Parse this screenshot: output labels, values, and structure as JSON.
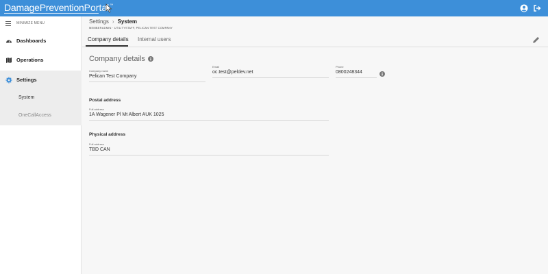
{
  "app": {
    "brand_part1": "DamagePrevention",
    "brand_part2": "Portal",
    "brand_tm": "™"
  },
  "sidebar": {
    "minimize_label": "MINIMIZE MENU",
    "items": [
      {
        "label": "Dashboards",
        "icon": "dashboard-icon"
      },
      {
        "label": "Operations",
        "icon": "map-icon"
      },
      {
        "label": "Settings",
        "icon": "gear-icon"
      }
    ],
    "sub_items": [
      {
        "label": "System"
      },
      {
        "label": "OneCallAccess"
      }
    ]
  },
  "header": {
    "breadcrumb_settings": "Settings",
    "breadcrumb_separator": "›",
    "breadcrumb_system": "System",
    "subcrumb": "MEMBERADMIN · UTILITYSTAFF, PELICAN TEST COMPANY"
  },
  "tabs": [
    {
      "label": "Company details",
      "active": true
    },
    {
      "label": "Internal users",
      "active": false
    }
  ],
  "company": {
    "section_title": "Company details",
    "company_name_label": "Company name",
    "company_name_value": "Pelican Test Company",
    "email_label": "Email",
    "email_value": "oc.test@peldev.net",
    "phone_label": "Phone",
    "phone_value": "0800248344"
  },
  "postal": {
    "heading": "Postal address",
    "label": "Full address",
    "value": "1A Wagener Pl Mt Albert AUK 1025"
  },
  "physical": {
    "heading": "Physical address",
    "label": "Full address",
    "value": "TBD CAN"
  },
  "colors": {
    "topbar": "#3d8fd9",
    "settings_accent": "#3d8fd9"
  }
}
